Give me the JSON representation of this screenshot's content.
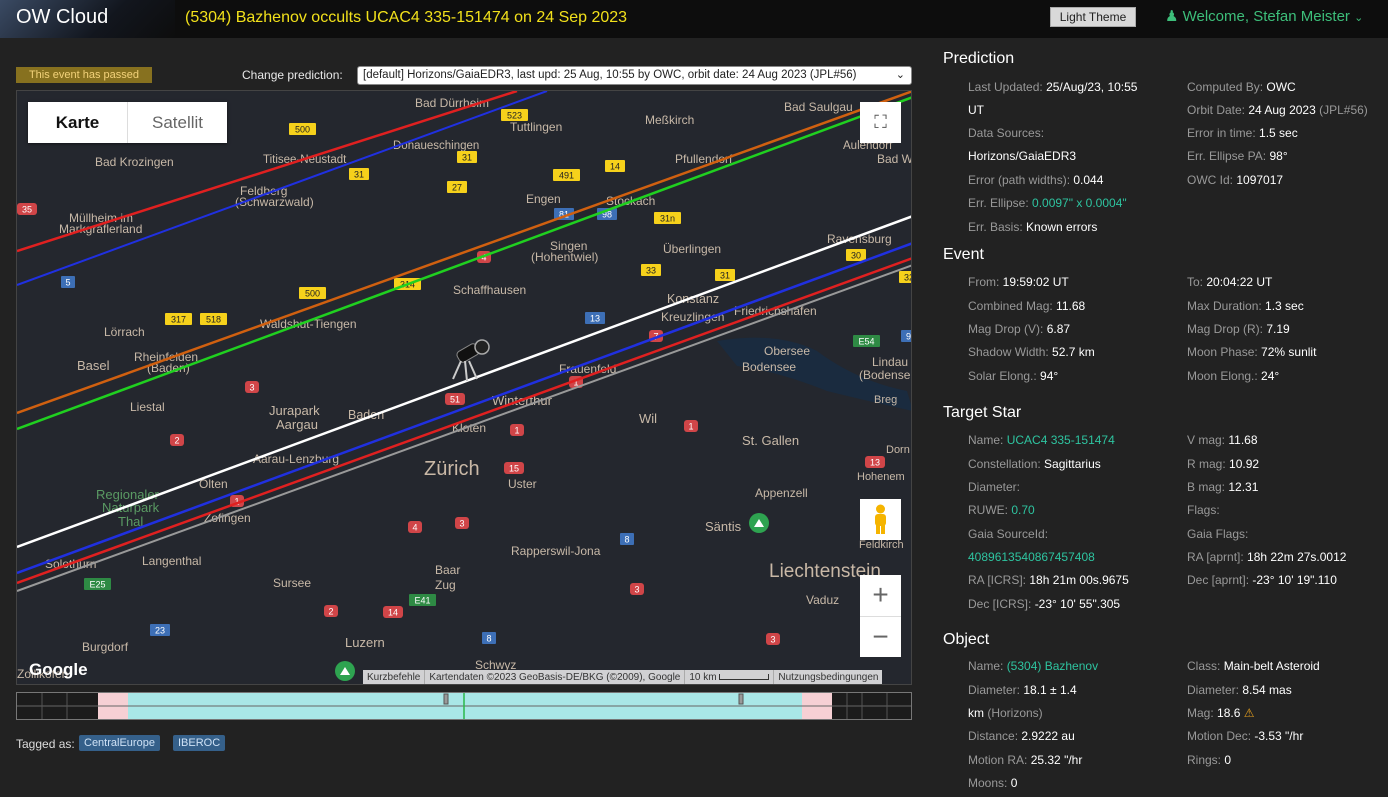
{
  "header": {
    "brand": "OW Cloud",
    "title": "(5304) Bazhenov occults UCAC4 335-151474 on 24 Sep 2023",
    "theme_button": "Light Theme",
    "welcome": "Welcome, Stefan Meister"
  },
  "status": {
    "passed": "This event has passed",
    "change_label": "Change prediction:",
    "prediction_selected": "[default] Horizons/GaiaEDR3, last upd: 25 Aug, 10:55 by OWC, orbit date: 24 Aug 2023 (JPL#56)"
  },
  "map": {
    "type_map": "Karte",
    "type_satellite": "Satellit",
    "google": "Google",
    "shortcuts": "Kurzbefehle",
    "copyright": "Kartendaten ©2023 GeoBasis-DE/BKG (©2009), Google",
    "scale": "10 km",
    "terms": "Nutzungsbedingungen",
    "zoom_in": "+",
    "zoom_out": "−",
    "place_labels": [
      {
        "text": "Bad Dürrheim"
      },
      {
        "text": "Bad Saulgau"
      },
      {
        "text": "Tuttlingen"
      },
      {
        "text": "Meßkirch"
      },
      {
        "text": "Donaueschingen"
      },
      {
        "text": "Aulendorf"
      },
      {
        "text": "Titisee-Neustadt"
      },
      {
        "text": "Bad Krozingen"
      },
      {
        "text": "Pfullendorf"
      },
      {
        "text": "Bad W"
      },
      {
        "text": "Feldberg"
      },
      {
        "text": "(Schwarzwald)"
      },
      {
        "text": "Engen"
      },
      {
        "text": "Stockach"
      },
      {
        "text": "Müllheim im"
      },
      {
        "text": "Markgräflerland"
      },
      {
        "text": "Singen"
      },
      {
        "text": "(Hohentwiel)"
      },
      {
        "text": "Überlingen"
      },
      {
        "text": "Ravensburg"
      },
      {
        "text": "Schaffhausen"
      },
      {
        "text": "Konstanz"
      },
      {
        "text": "Kreuzlingen"
      },
      {
        "text": "Friedrichshafen"
      },
      {
        "text": "Lörrach"
      },
      {
        "text": "Waldshut-Tiengen"
      },
      {
        "text": "Rheinfelden"
      },
      {
        "text": "(Baden)"
      },
      {
        "text": "Basel"
      },
      {
        "text": "Frauenfeld"
      },
      {
        "text": "Lindau"
      },
      {
        "text": "(Bodense"
      },
      {
        "text": "Liestal"
      },
      {
        "text": "Jurapark"
      },
      {
        "text": "Aargau"
      },
      {
        "text": "Baden"
      },
      {
        "text": "Winterthur"
      },
      {
        "text": "Wil"
      },
      {
        "text": "Kloten"
      },
      {
        "text": "St. Gallen"
      },
      {
        "text": "Aarau-Lenzburg"
      },
      {
        "text": "Zürich"
      },
      {
        "text": "Uster"
      },
      {
        "text": "Hohenem"
      },
      {
        "text": "Olten"
      },
      {
        "text": "Regionaler"
      },
      {
        "text": "Naturpark"
      },
      {
        "text": "Thal"
      },
      {
        "text": "Appenzell"
      },
      {
        "text": "Zofingen"
      },
      {
        "text": "Säntis"
      },
      {
        "text": "Feldkirch"
      },
      {
        "text": "Rapperswil-Jona"
      },
      {
        "text": "Solothurn"
      },
      {
        "text": "Langenthal"
      },
      {
        "text": "Baar"
      },
      {
        "text": "Zug"
      },
      {
        "text": "Liechtenstein"
      },
      {
        "text": "Sursee"
      },
      {
        "text": "Vaduz"
      },
      {
        "text": "Burgdorf"
      },
      {
        "text": "Luzern"
      },
      {
        "text": "Schwyz"
      },
      {
        "text": "Zollikofen"
      },
      {
        "text": "Bodensee"
      },
      {
        "text": "Dorn"
      },
      {
        "text": "Breg"
      },
      {
        "text": "Obersee"
      }
    ],
    "road_shields": [
      {
        "text": "523"
      },
      {
        "text": "500"
      },
      {
        "text": "31"
      },
      {
        "text": "14"
      },
      {
        "text": "491"
      },
      {
        "text": "31"
      },
      {
        "text": "27"
      },
      {
        "text": "81"
      },
      {
        "text": "98"
      },
      {
        "text": "31n"
      },
      {
        "text": "35"
      },
      {
        "text": "33"
      },
      {
        "text": "31"
      },
      {
        "text": "30"
      },
      {
        "text": "32"
      },
      {
        "text": "5"
      },
      {
        "text": "500"
      },
      {
        "text": "314"
      },
      {
        "text": "317"
      },
      {
        "text": "518"
      },
      {
        "text": "13"
      },
      {
        "text": "E54"
      },
      {
        "text": "96"
      },
      {
        "text": "7"
      },
      {
        "text": "3"
      },
      {
        "text": "1"
      },
      {
        "text": "51"
      },
      {
        "text": "2"
      },
      {
        "text": "1"
      },
      {
        "text": "1"
      },
      {
        "text": "15"
      },
      {
        "text": "13"
      },
      {
        "text": "1"
      },
      {
        "text": "4"
      },
      {
        "text": "3"
      },
      {
        "text": "8"
      },
      {
        "text": "E25"
      },
      {
        "text": "E41"
      },
      {
        "text": "3"
      },
      {
        "text": "2"
      },
      {
        "text": "14"
      },
      {
        "text": "23"
      },
      {
        "text": "8"
      },
      {
        "text": "3"
      },
      {
        "text": "4"
      }
    ]
  },
  "tags": {
    "label": "Tagged as:",
    "items": [
      "CentralEurope",
      "IBEROC"
    ]
  },
  "prediction": {
    "title": "Prediction",
    "left": [
      {
        "label": "Last Updated: ",
        "value": "25/Aug/23, 10:55"
      },
      {
        "label": "",
        "value": "UT"
      },
      {
        "label": "Data Sources:",
        "value": ""
      },
      {
        "label": "",
        "value": "Horizons/GaiaEDR3"
      },
      {
        "label": "Error (path widths): ",
        "value": "0.044"
      },
      {
        "label": "Err. Ellipse: ",
        "value": "0.0097\" x 0.0004\""
      },
      {
        "label": "Err. Basis: ",
        "value": "Known errors"
      }
    ],
    "right": [
      {
        "label": "Computed By: ",
        "value": "OWC"
      },
      {
        "label": "Orbit Date: ",
        "value": "24 Aug 2023",
        "suffix": " (JPL#56)"
      },
      {
        "label": "Error in time: ",
        "value": "1.5 sec"
      },
      {
        "label": "Err. Ellipse PA: ",
        "value": "98°"
      },
      {
        "label": "OWC Id: ",
        "value": "1097017"
      }
    ]
  },
  "event": {
    "title": "Event",
    "left": [
      {
        "label": "From: ",
        "value": "19:59:02 UT"
      },
      {
        "label": "Combined Mag: ",
        "value": "11.68"
      },
      {
        "label": "Mag Drop (V): ",
        "value": "6.87"
      },
      {
        "label": "Shadow Width: ",
        "value": "52.7 km"
      },
      {
        "label": "Solar Elong.: ",
        "value": "94°"
      }
    ],
    "right": [
      {
        "label": "To: ",
        "value": "20:04:22 UT"
      },
      {
        "label": "Max Duration: ",
        "value": "1.3 sec"
      },
      {
        "label": "Mag Drop (R): ",
        "value": "7.19"
      },
      {
        "label": "Moon Phase: ",
        "value": "72% sunlit"
      },
      {
        "label": "Moon Elong.: ",
        "value": "24°"
      }
    ]
  },
  "star": {
    "title": "Target Star",
    "left": [
      {
        "label": "Name: ",
        "value": "UCAC4 335-151474"
      },
      {
        "label": "Constellation: ",
        "value": "Sagittarius"
      },
      {
        "label": "Diameter:",
        "value": ""
      },
      {
        "label": "RUWE: ",
        "value": "0.70"
      },
      {
        "label": "Gaia SourceId:",
        "value": ""
      },
      {
        "label": "",
        "value": "4089613540867457408"
      },
      {
        "label": "RA [ICRS]: ",
        "value": "18h 21m 00s.9675"
      },
      {
        "label": "Dec [ICRS]: ",
        "value": "-23° 10' 55\".305"
      }
    ],
    "right": [
      {
        "label": "V mag: ",
        "value": "11.68"
      },
      {
        "label": "R mag: ",
        "value": "10.92"
      },
      {
        "label": "B mag: ",
        "value": "12.31"
      },
      {
        "label": "Flags:",
        "value": ""
      },
      {
        "label": "Gaia Flags:",
        "value": ""
      },
      {
        "label": "RA [aprnt]: ",
        "value": "18h 22m 27s.0012"
      },
      {
        "label": "Dec [aprnt]: ",
        "value": "-23° 10' 19\".110"
      }
    ]
  },
  "object": {
    "title": "Object",
    "left": [
      {
        "label": "Name: ",
        "value": "(5304) Bazhenov"
      },
      {
        "label": "Diameter: ",
        "value": "18.1 ± 1.4"
      },
      {
        "label": "",
        "value": "km",
        "suffix": " (Horizons)"
      },
      {
        "label": "Distance: ",
        "value": "2.9222 au"
      },
      {
        "label": "Motion RA: ",
        "value": "25.32 \"/hr"
      },
      {
        "label": "Moons: ",
        "value": "0"
      }
    ],
    "right": [
      {
        "label": "Class: ",
        "value": "Main-belt Asteroid"
      },
      {
        "label": "Diameter: ",
        "value": "8.54 mas"
      },
      {
        "label": "Mag: ",
        "value": "18.6"
      },
      {
        "label": "Motion Dec: ",
        "value": "-3.53 \"/hr"
      },
      {
        "label": "Rings: ",
        "value": "0"
      }
    ]
  },
  "colors": {
    "accent_green": "#2ec4a0",
    "title_yellow": "#f2e11b",
    "path_red": "#e02020",
    "path_blue": "#2030e0",
    "path_green": "#20d020",
    "path_orange": "#d06010",
    "center_white": "#ffffff"
  }
}
